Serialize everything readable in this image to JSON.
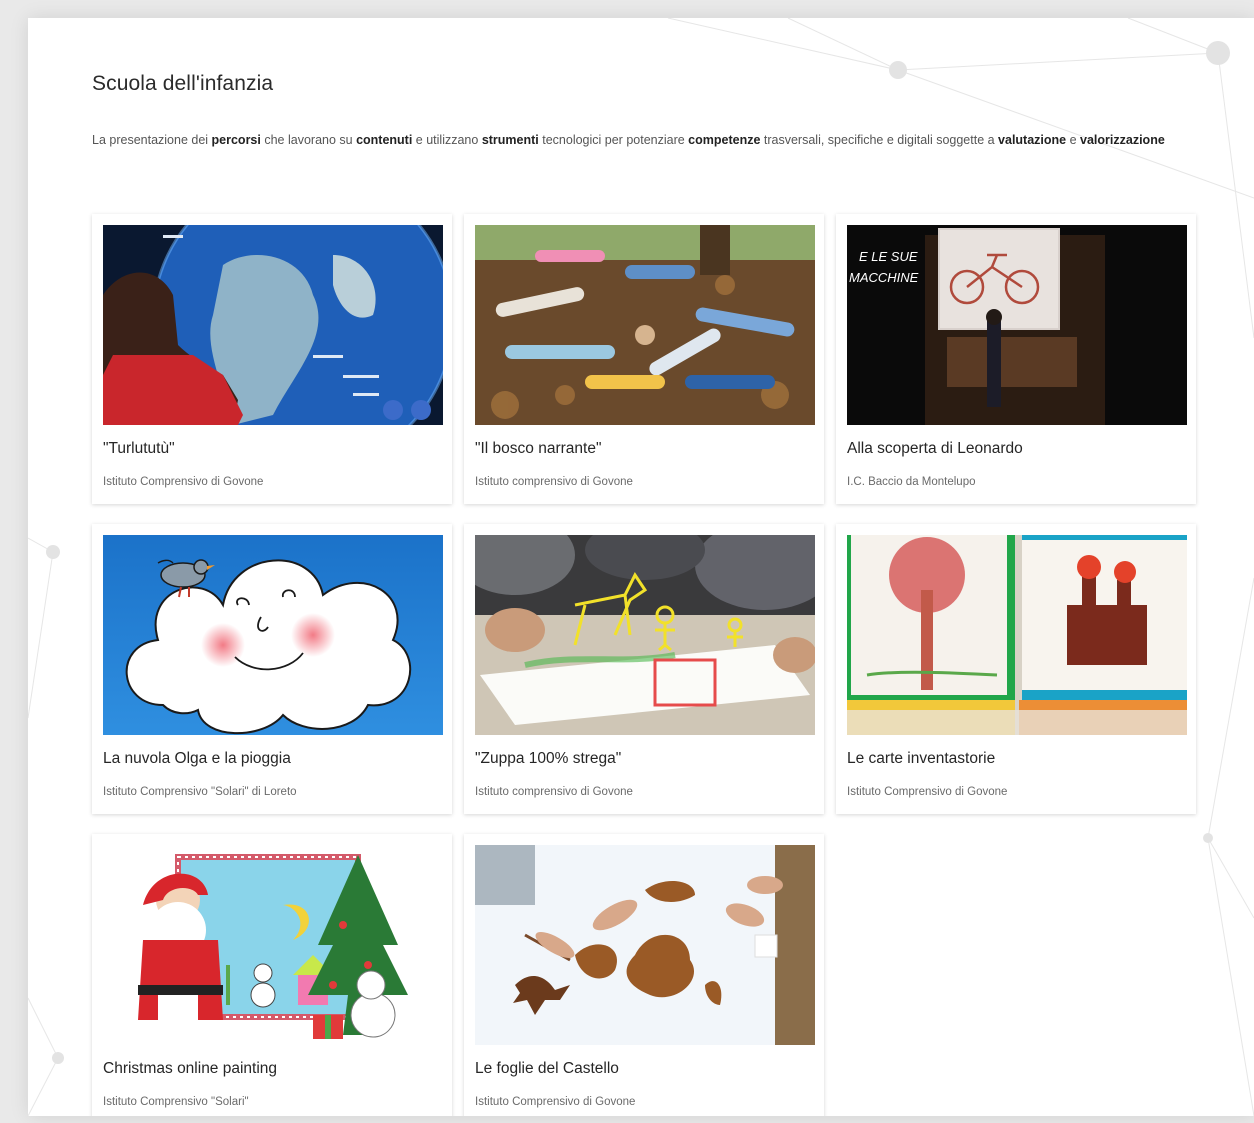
{
  "section": {
    "title": "Scuola dell'infanzia",
    "intro_parts": [
      {
        "t": "La presentazione dei ",
        "b": false
      },
      {
        "t": "percorsi",
        "b": true
      },
      {
        "t": " che lavorano su ",
        "b": false
      },
      {
        "t": "contenuti",
        "b": true
      },
      {
        "t": " e utilizzano ",
        "b": false
      },
      {
        "t": "strumenti",
        "b": true
      },
      {
        "t": " tecnologici per potenziare ",
        "b": false
      },
      {
        "t": "competenze",
        "b": true
      },
      {
        "t": " trasversali, specifiche e digitali soggette a ",
        "b": false
      },
      {
        "t": "valutazione",
        "b": true
      },
      {
        "t": " e ",
        "b": false
      },
      {
        "t": "valorizzazione",
        "b": true
      }
    ]
  },
  "cards": [
    {
      "title": "\"Turlututù\"",
      "subtitle": "Istituto Comprensivo di Govone",
      "image": "globe-touchscreen-photo"
    },
    {
      "title": "\"Il bosco narrante\"",
      "subtitle": "Istituto comprensivo di Govone",
      "image": "children-lying-leaves-photo"
    },
    {
      "title": "Alla scoperta di Leonardo",
      "subtitle": "I.C. Baccio da Montelupo",
      "image": "bicycle-whiteboard-photo",
      "image_text": [
        "E LE SUE",
        "MACCHINE"
      ]
    },
    {
      "title": "La nuvola Olga e la pioggia",
      "subtitle": "Istituto Comprensivo \"Solari\" di Loreto",
      "image": "cloud-drawing"
    },
    {
      "title": "\"Zuppa 100% strega\"",
      "subtitle": "Istituto comprensivo di Govone",
      "image": "children-drawing-ar-photo"
    },
    {
      "title": "Le carte inventastorie",
      "subtitle": "Istituto Comprensivo di Govone",
      "image": "children-drawings-photo"
    },
    {
      "title": "Christmas online painting",
      "subtitle": "Istituto Comprensivo \"Solari\"",
      "image": "santa-christmas-drawing"
    },
    {
      "title": "Le foglie del Castello",
      "subtitle": "Istituto Comprensivo di Govone",
      "image": "leaves-lighttable-photo"
    }
  ]
}
